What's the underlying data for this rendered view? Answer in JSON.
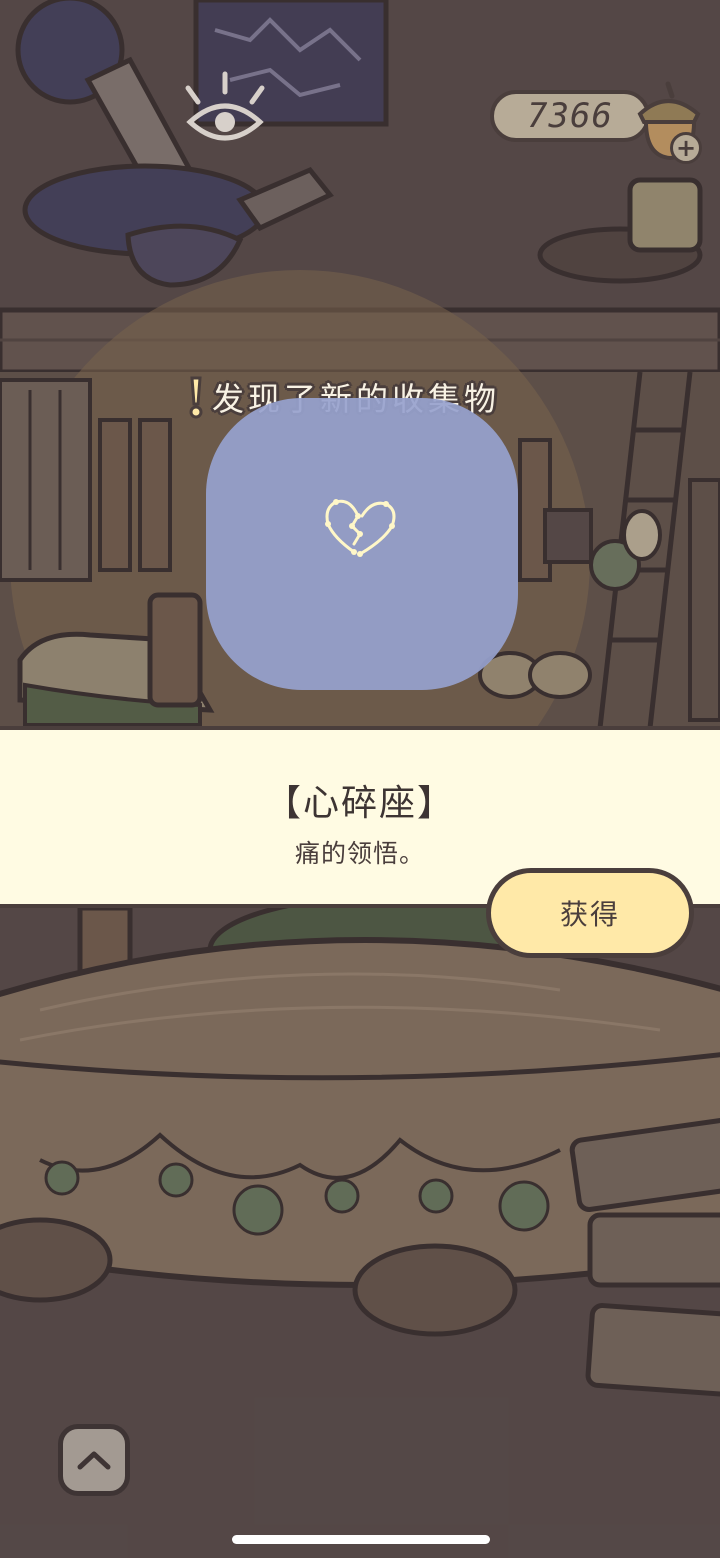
{
  "currency": {
    "amount": "7366",
    "plus_label": "+"
  },
  "popup": {
    "discover_title": "发现了新的收集物",
    "item_name": "【心碎座】",
    "item_description": "痛的领悟。",
    "obtain_label": "获得"
  },
  "icons": {
    "eye": "eye-icon",
    "acorn": "acorn-icon",
    "exclamation": "exclamation-icon",
    "constellation": "broken-heart-constellation-icon",
    "chevron_up": "chevron-up-icon"
  },
  "colors": {
    "band_background": "#fffbe3",
    "button_fill": "#ffe9a8",
    "card_fill": "#97a2ce",
    "outline": "#4a3e3c",
    "scene_base": "#5b4d4d"
  }
}
